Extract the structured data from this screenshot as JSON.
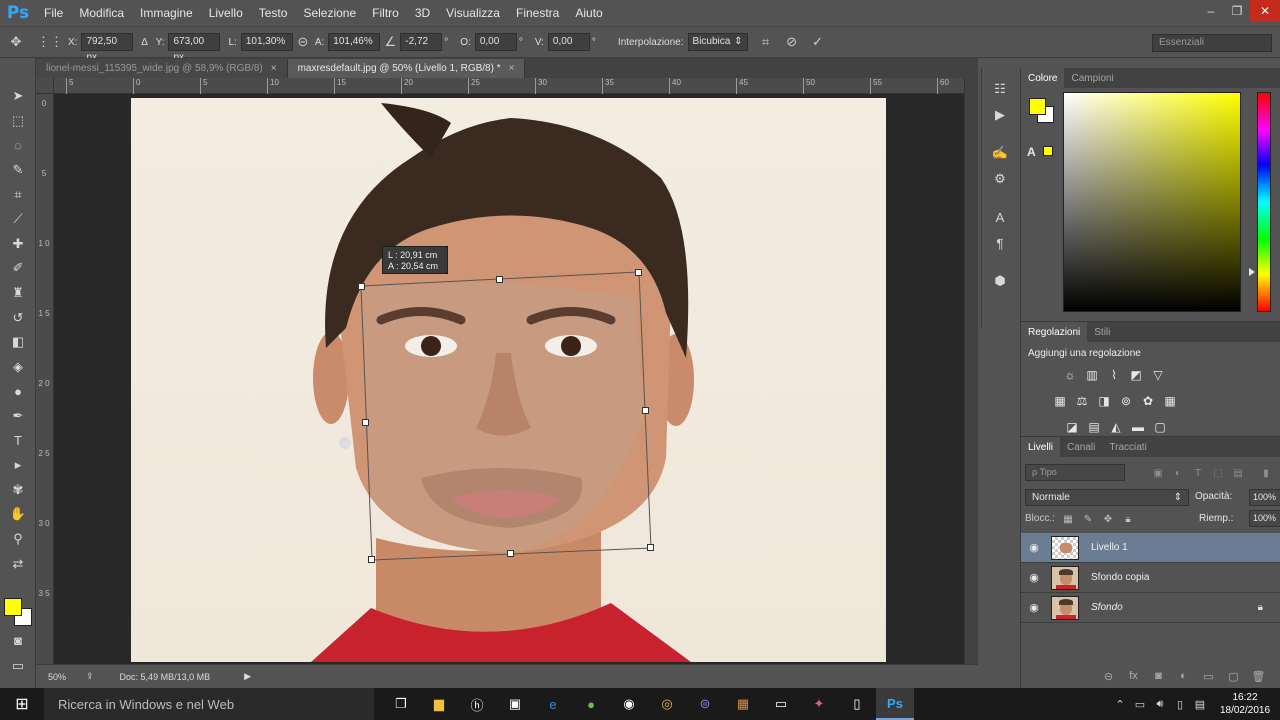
{
  "app": {
    "logo": "Ps",
    "menu": [
      "File",
      "Modifica",
      "Immagine",
      "Livello",
      "Testo",
      "Selezione",
      "Filtro",
      "3D",
      "Visualizza",
      "Finestra",
      "Aiuto"
    ],
    "window_controls": [
      "–",
      "❐",
      "✕"
    ]
  },
  "options": {
    "x_label": "X:",
    "x_value": "792,50 px",
    "y_label": "Y:",
    "y_value": "673,00 px",
    "w_label": "L:",
    "w_value": "101,30%",
    "h_label": "A:",
    "h_value": "101,46%",
    "rot_value": "-2,72",
    "rot_unit": "°",
    "hskew_label": "O:",
    "hskew_value": "0,00",
    "hskew_unit": "°",
    "vskew_label": "V:",
    "vskew_value": "0,00",
    "vskew_unit": "°",
    "interp_label": "Interpolazione:",
    "interp_value": "Bicubica",
    "workspace": "Essenziali"
  },
  "doc_tabs": [
    {
      "label": "lionel-messi_115395_wide.jpg @ 58,9% (RGB/8)",
      "close": "×"
    },
    {
      "label": "maxresdefault.jpg @ 50% (Livello 1, RGB/8) *",
      "close": "×"
    }
  ],
  "ruler": {
    "top_ticks": [
      "5",
      "0",
      "5",
      "10",
      "15",
      "20",
      "25",
      "30",
      "35",
      "40",
      "45",
      "50",
      "55",
      "60"
    ],
    "left_ticks": [
      "0",
      "5",
      "1 0",
      "1 5",
      "2 0",
      "2 5",
      "3 0",
      "3 5"
    ]
  },
  "canvas": {
    "tooltip_w": "L :   20,91 cm",
    "tooltip_h": "A :   20,54 cm"
  },
  "status": {
    "zoom": "50%",
    "doc_info": "Doc: 5,49 MB/13,0 MB"
  },
  "panels": {
    "color_tabs": [
      "Colore",
      "Campioni"
    ],
    "adjust_tabs": [
      "Regolazioni",
      "Stili"
    ],
    "adjust_title": "Aggiungi una regolazione",
    "layers_tabs": [
      "Livelli",
      "Canali",
      "Tracciati"
    ],
    "filter_placeholder": "ρ Tipo",
    "blend_mode": "Normale",
    "opacity_label": "Opacità:",
    "opacity_value": "100%",
    "lock_label": "Blocc.:",
    "fill_label": "Riemp.:",
    "fill_value": "100%",
    "layers": [
      {
        "name": "Livello 1",
        "selected": true
      },
      {
        "name": "Sfondo copia",
        "selected": false
      },
      {
        "name": "Sfondo",
        "selected": false,
        "locked": true
      }
    ]
  },
  "taskbar": {
    "search": "Ricerca in Windows e nel Web",
    "time": "16:22",
    "date": "18/02/2016"
  },
  "colors": {
    "foreground": "#ffff00",
    "background": "#ffffff",
    "accent": "#31a8ff"
  }
}
